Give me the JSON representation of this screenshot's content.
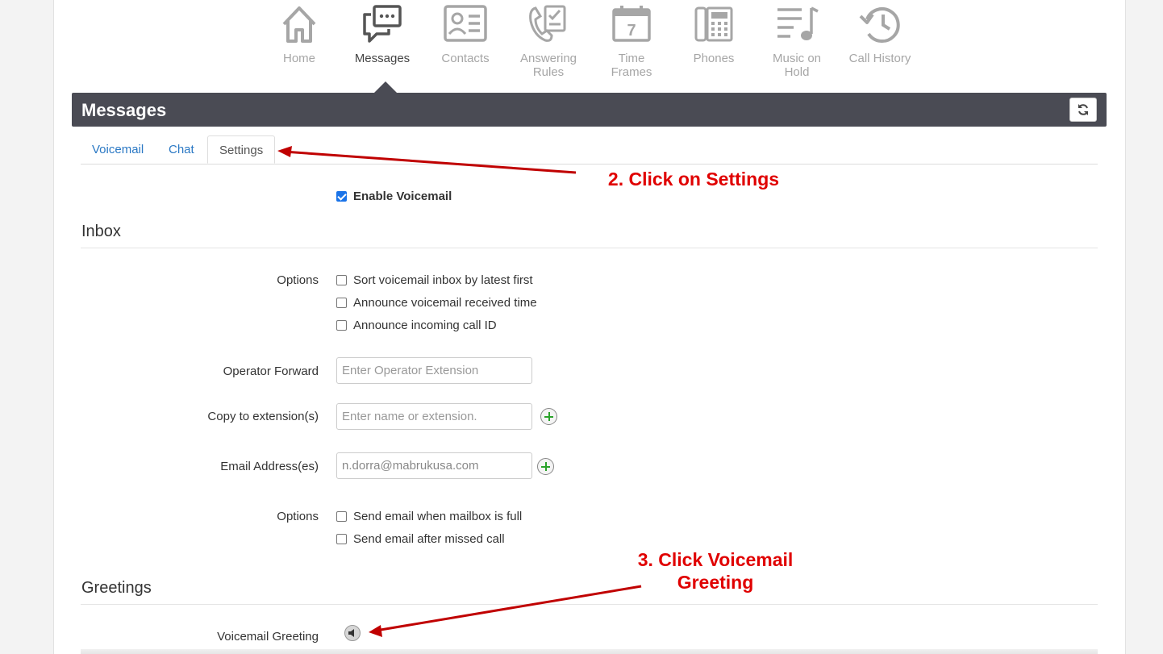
{
  "nav": {
    "items": [
      {
        "label": "Home",
        "icon": "home-icon"
      },
      {
        "label": "Messages",
        "icon": "messages-icon"
      },
      {
        "label": "Contacts",
        "icon": "contacts-icon"
      },
      {
        "label": "Answering\nRules",
        "icon": "answering-rules-icon"
      },
      {
        "label": "Time\nFrames",
        "icon": "calendar-icon"
      },
      {
        "label": "Phones",
        "icon": "phone-icon"
      },
      {
        "label": "Music on\nHold",
        "icon": "music-icon"
      },
      {
        "label": "Call History",
        "icon": "history-icon"
      }
    ],
    "active": "Messages",
    "calendar_day": "7"
  },
  "panel": {
    "title": "Messages",
    "refresh_icon": "refresh-icon"
  },
  "tabs": [
    "Voicemail",
    "Chat",
    "Settings"
  ],
  "active_tab": "Settings",
  "enable_voicemail": {
    "label": "Enable Voicemail",
    "checked": true
  },
  "inbox": {
    "title": "Inbox",
    "options_label": "Options",
    "options": [
      {
        "label": "Sort voicemail inbox by latest first",
        "checked": false
      },
      {
        "label": "Announce voicemail received time",
        "checked": false
      },
      {
        "label": "Announce incoming call ID",
        "checked": false
      }
    ],
    "operator_forward": {
      "label": "Operator Forward",
      "placeholder": "Enter Operator Extension"
    },
    "copy_to": {
      "label": "Copy to extension(s)",
      "placeholder": "Enter name or extension."
    },
    "email": {
      "label": "Email Address(es)",
      "value": "n.dorra@mabrukusa.com"
    },
    "email_options_label": "Options",
    "email_options": [
      {
        "label": "Send email when mailbox is full",
        "checked": false
      },
      {
        "label": "Send email after missed call",
        "checked": false
      }
    ]
  },
  "greetings": {
    "title": "Greetings",
    "voicemail_greeting_label": "Voicemail Greeting"
  },
  "annotations": {
    "step2": "2. Click on Settings",
    "step3_line1": "3. Click Voicemail",
    "step3_line2": "Greeting"
  },
  "colors": {
    "header": "#4a4b54",
    "link": "#2a78c4",
    "annotation": "#e00000",
    "checkbox": "#1a73e8",
    "add": "#2aa22a"
  }
}
